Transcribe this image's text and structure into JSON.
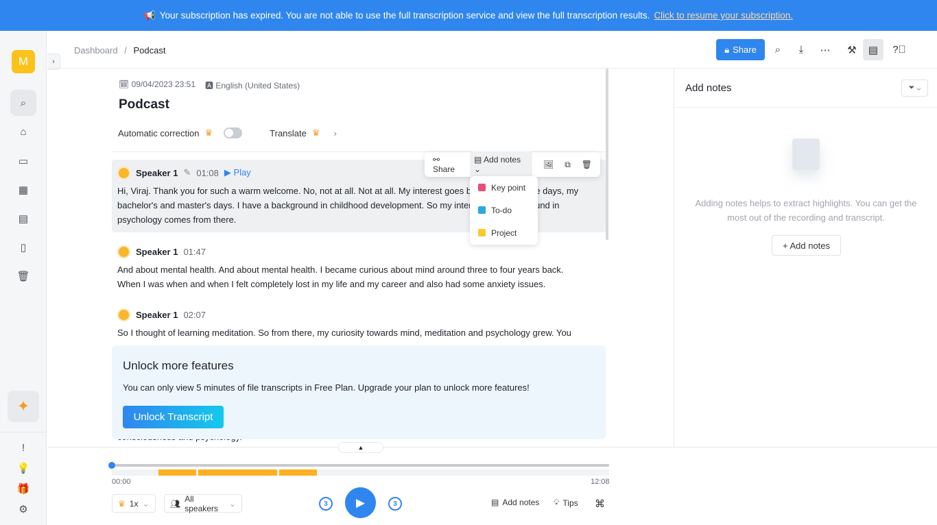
{
  "banner": {
    "icon": "megaphone-icon",
    "message": "Your subscription has expired. You are not able to use the full transcription service and view the full transcription results.",
    "link": "Click to resume your subscription."
  },
  "sidebar": {
    "avatar": "M",
    "items": [
      "search-icon",
      "home-icon",
      "folder-icon",
      "calendar-check-icon",
      "calendar-icon",
      "document-icon",
      "trash-icon"
    ],
    "bottom": [
      "feedback-icon",
      "bulb-icon",
      "gift-icon",
      "settings-icon"
    ]
  },
  "header": {
    "breadcrumb_root": "Dashboard",
    "breadcrumb_sep": "/",
    "breadcrumb_current": "Podcast",
    "share": "Share"
  },
  "doc": {
    "date": "09/04/2023 23:51",
    "language": "English (United States)",
    "title": "Podcast",
    "auto_correction": "Automatic correction",
    "translate": "Translate"
  },
  "segments": [
    {
      "speaker": "Speaker 1",
      "time": "01:08",
      "play": "Play",
      "lines": [
        "Hi, Viraj. Thank you for such a warm welcome. No, not at all. Not at all. My interest goes back to my college days, my",
        "bachelor's and master's days. I have a background in childhood development. So my interest and background in",
        "psychology comes from there."
      ]
    },
    {
      "speaker": "Speaker 1",
      "time": "01:47",
      "lines": [
        "And about mental health. And about mental health. I became curious about mind around three to four years back.",
        "When I was when and when I felt completely lost in my life and my career and also had some anxiety issues."
      ]
    },
    {
      "speaker": "Speaker 1",
      "time": "02:07",
      "lines": [
        "So I thought of learning meditation. So from there, my curiosity towards mind, meditation and psychology grew. You"
      ]
    }
  ],
  "trailing_line": "consciousness and psychology.",
  "toolbar": {
    "share": "Share",
    "add_notes": "Add notes"
  },
  "notes_menu": [
    {
      "label": "Key point",
      "color": "#ec4d78"
    },
    {
      "label": "To-do",
      "color": "#2aa9e0"
    },
    {
      "label": "Project",
      "color": "#fbc92b"
    }
  ],
  "unlock": {
    "title": "Unlock more features",
    "text": "You can only view 5 minutes of file transcripts in Free Plan. Upgrade your plan to unlock more features!",
    "button": "Unlock Transcript"
  },
  "notes_panel": {
    "title": "Add notes",
    "hint": "Adding notes helps to extract highlights. You can get the most out of the recording and transcript.",
    "button": "+ Add notes"
  },
  "player": {
    "current": "00:00",
    "duration": "12:08",
    "progress": 0,
    "speed": "1x",
    "speakers": "All speakers",
    "skip_back": "3",
    "skip_fwd": "3",
    "add_notes": "Add notes",
    "tips": "Tips"
  }
}
